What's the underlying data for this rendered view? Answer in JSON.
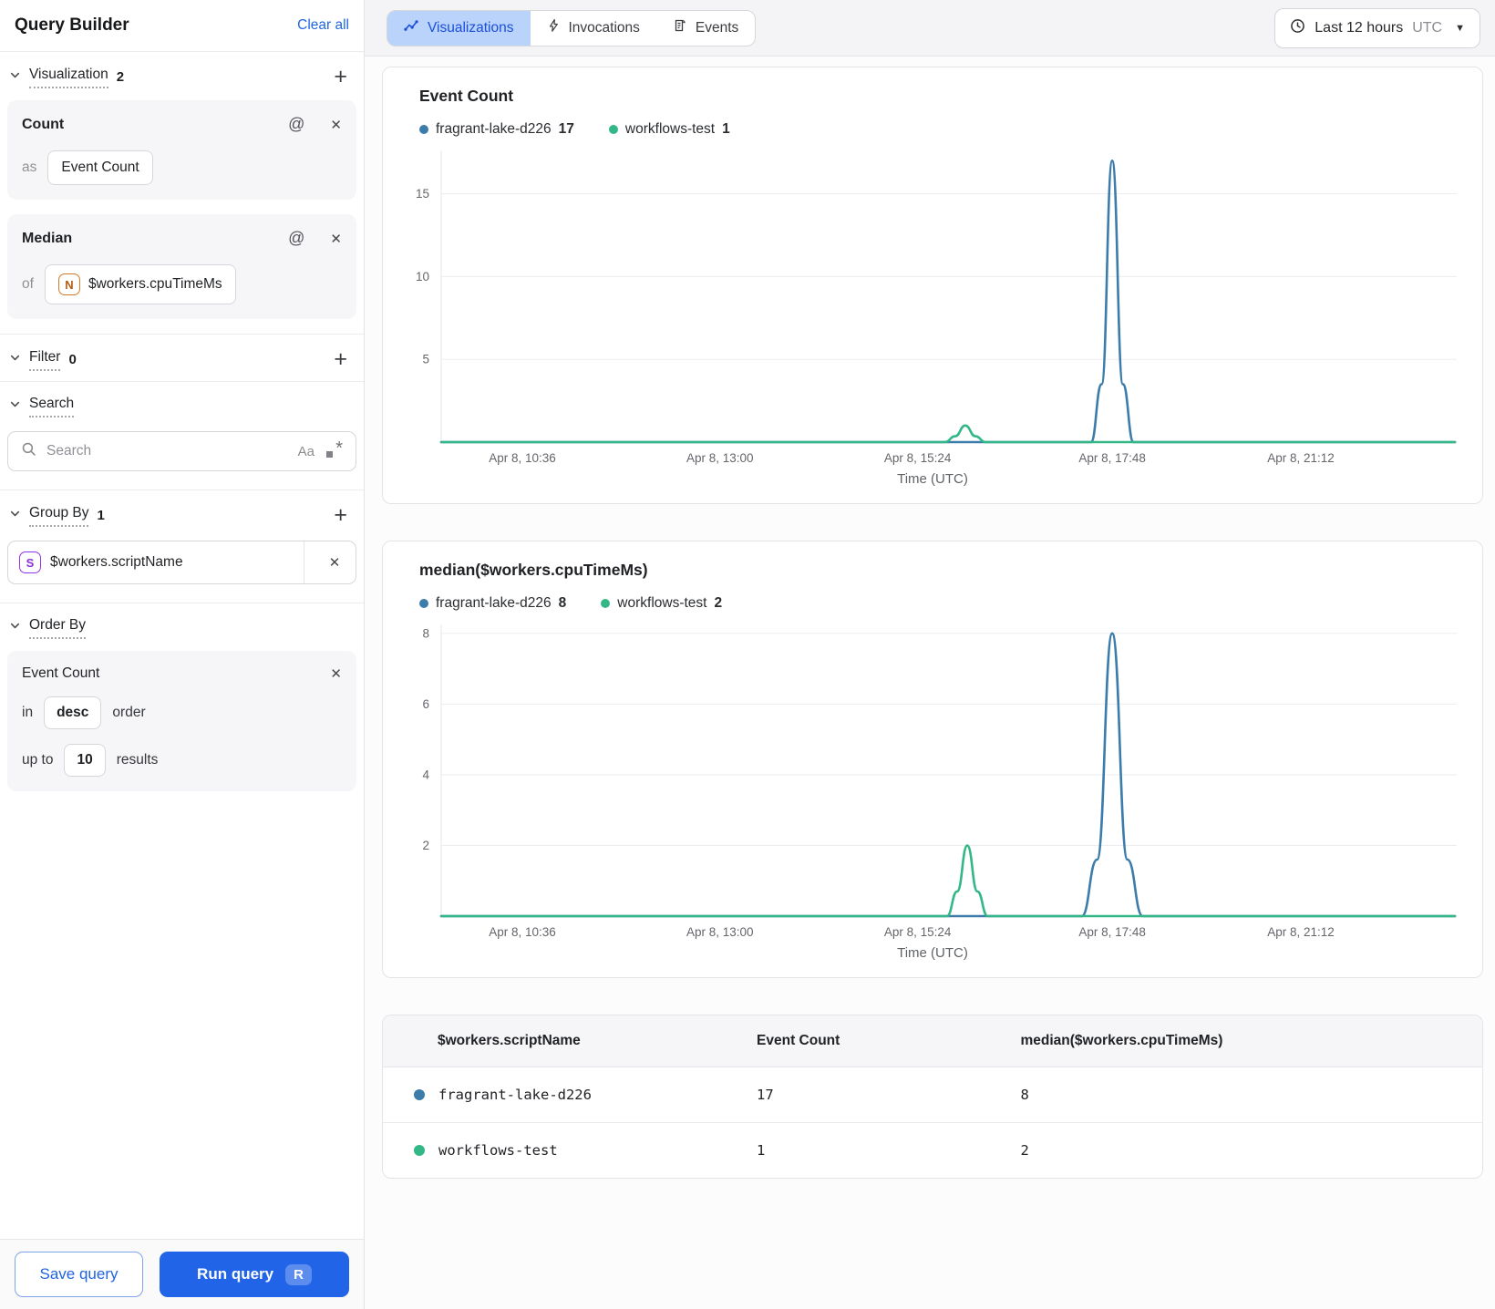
{
  "icons": {
    "at": "@",
    "close": "✕",
    "plus": "+",
    "caret": "▼",
    "case": "Aa",
    "star": "*"
  },
  "colors": {
    "accent_blue": "#2264e8",
    "link_blue": "#2166e0",
    "active_tab_bg": "#b9d3fb",
    "active_tab_text": "#1b4fd8",
    "series_blue": "#3b7cab",
    "series_green": "#34b786"
  },
  "sidebar": {
    "title": "Query Builder",
    "clear_all": "Clear all",
    "visualization": {
      "label": "Visualization",
      "count": "2"
    },
    "count_card": {
      "title": "Count",
      "as_label": "as",
      "value": "Event Count"
    },
    "median_card": {
      "title": "Median",
      "of_label": "of",
      "field_badge": "N",
      "value": "$workers.cpuTimeMs"
    },
    "filter": {
      "label": "Filter",
      "count": "0"
    },
    "search": {
      "label": "Search",
      "placeholder": "Search"
    },
    "group_by": {
      "label": "Group By",
      "count": "1",
      "item_badge": "S",
      "item": "$workers.scriptName"
    },
    "order_by": {
      "label": "Order By",
      "field": "Event Count",
      "in_label": "in",
      "direction": "desc",
      "order_label": "order",
      "up_to_label": "up to",
      "limit": "10",
      "results_label": "results"
    },
    "save_button": "Save query",
    "run_button": "Run query",
    "run_shortcut": "R"
  },
  "topbar": {
    "tabs": [
      {
        "label": "Visualizations",
        "icon": "line-chart",
        "active": true
      },
      {
        "label": "Invocations",
        "icon": "lightning",
        "active": false
      },
      {
        "label": "Events",
        "icon": "events",
        "active": false
      }
    ],
    "time_range": {
      "label": "Last 12 hours",
      "timezone": "UTC"
    }
  },
  "chart_data": [
    {
      "type": "line",
      "title": "Event Count",
      "xlabel": "Time (UTC)",
      "x_ticks": [
        "Apr 8, 10:36",
        "Apr 8, 13:00",
        "Apr 8, 15:24",
        "Apr 8, 17:48",
        "Apr 8, 21:12"
      ],
      "x_ticks_pct": [
        0.08,
        0.275,
        0.47,
        0.662,
        0.848
      ],
      "y_ticks": [
        5,
        10,
        15
      ],
      "ylim": [
        0,
        17.4
      ],
      "grid": true,
      "legend_position": "top-left",
      "series": [
        {
          "name": "fragrant-lake-d226",
          "color": "#3b7cab",
          "total": 17,
          "peak": {
            "time": "Apr 8, ~17:50",
            "value": 17
          },
          "points_pct": [
            [
              0,
              0
            ],
            [
              0.641,
              0
            ],
            [
              0.6515,
              3.5
            ],
            [
              0.662,
              17
            ],
            [
              0.6725,
              3.5
            ],
            [
              0.683,
              0
            ],
            [
              1,
              0
            ]
          ]
        },
        {
          "name": "workflows-test",
          "color": "#34b786",
          "total": 1,
          "peak": {
            "time": "Apr 8, ~15:45",
            "value": 1
          },
          "points_pct": [
            [
              0,
              0
            ],
            [
              0.497,
              0
            ],
            [
              0.507,
              0.35
            ],
            [
              0.517,
              1
            ],
            [
              0.527,
              0.35
            ],
            [
              0.537,
              0
            ],
            [
              1,
              0
            ]
          ]
        }
      ]
    },
    {
      "type": "line",
      "title": "median($workers.cpuTimeMs)",
      "xlabel": "Time (UTC)",
      "x_ticks": [
        "Apr 8, 10:36",
        "Apr 8, 13:00",
        "Apr 8, 15:24",
        "Apr 8, 17:48",
        "Apr 8, 21:12"
      ],
      "x_ticks_pct": [
        0.08,
        0.275,
        0.47,
        0.662,
        0.848
      ],
      "y_ticks": [
        2,
        4,
        6,
        8
      ],
      "ylim": [
        0,
        8.15
      ],
      "grid": true,
      "legend_position": "top-left",
      "series": [
        {
          "name": "fragrant-lake-d226",
          "color": "#3b7cab",
          "total": 8,
          "peak": {
            "time": "Apr 8, ~17:50",
            "value": 8
          },
          "points_pct": [
            [
              0,
              0
            ],
            [
              0.632,
              0
            ],
            [
              0.647,
              1.6
            ],
            [
              0.662,
              8
            ],
            [
              0.677,
              1.6
            ],
            [
              0.692,
              0
            ],
            [
              1,
              0
            ]
          ]
        },
        {
          "name": "workflows-test",
          "color": "#34b786",
          "total": 2,
          "peak": {
            "time": "Apr 8, ~15:45",
            "value": 2
          },
          "points_pct": [
            [
              0,
              0
            ],
            [
              0.499,
              0
            ],
            [
              0.509,
              0.7
            ],
            [
              0.519,
              2
            ],
            [
              0.529,
              0.7
            ],
            [
              0.539,
              0
            ],
            [
              1,
              0
            ]
          ]
        }
      ]
    }
  ],
  "table": {
    "headers": [
      "$workers.scriptName",
      "Event Count",
      "median($workers.cpuTimeMs)"
    ],
    "rows": [
      {
        "dot_color": "#3b7cab",
        "name": "fragrant-lake-d226",
        "event_count": "17",
        "median": "8"
      },
      {
        "dot_color": "#34b786",
        "name": "workflows-test",
        "event_count": "1",
        "median": "2"
      }
    ]
  }
}
